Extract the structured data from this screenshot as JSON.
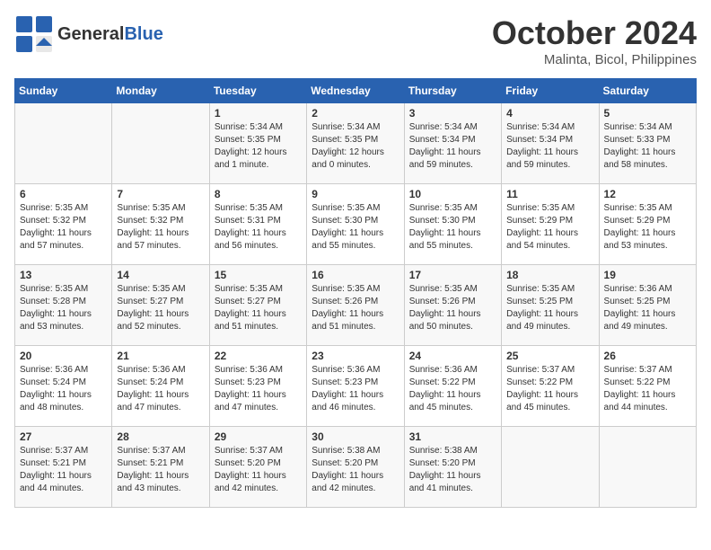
{
  "header": {
    "logo_general": "General",
    "logo_blue": "Blue",
    "month": "October 2024",
    "location": "Malinta, Bicol, Philippines"
  },
  "days_of_week": [
    "Sunday",
    "Monday",
    "Tuesday",
    "Wednesday",
    "Thursday",
    "Friday",
    "Saturday"
  ],
  "weeks": [
    [
      {
        "day": "",
        "info": ""
      },
      {
        "day": "",
        "info": ""
      },
      {
        "day": "1",
        "info": "Sunrise: 5:34 AM\nSunset: 5:35 PM\nDaylight: 12 hours\nand 1 minute."
      },
      {
        "day": "2",
        "info": "Sunrise: 5:34 AM\nSunset: 5:35 PM\nDaylight: 12 hours\nand 0 minutes."
      },
      {
        "day": "3",
        "info": "Sunrise: 5:34 AM\nSunset: 5:34 PM\nDaylight: 11 hours\nand 59 minutes."
      },
      {
        "day": "4",
        "info": "Sunrise: 5:34 AM\nSunset: 5:34 PM\nDaylight: 11 hours\nand 59 minutes."
      },
      {
        "day": "5",
        "info": "Sunrise: 5:34 AM\nSunset: 5:33 PM\nDaylight: 11 hours\nand 58 minutes."
      }
    ],
    [
      {
        "day": "6",
        "info": "Sunrise: 5:35 AM\nSunset: 5:32 PM\nDaylight: 11 hours\nand 57 minutes."
      },
      {
        "day": "7",
        "info": "Sunrise: 5:35 AM\nSunset: 5:32 PM\nDaylight: 11 hours\nand 57 minutes."
      },
      {
        "day": "8",
        "info": "Sunrise: 5:35 AM\nSunset: 5:31 PM\nDaylight: 11 hours\nand 56 minutes."
      },
      {
        "day": "9",
        "info": "Sunrise: 5:35 AM\nSunset: 5:30 PM\nDaylight: 11 hours\nand 55 minutes."
      },
      {
        "day": "10",
        "info": "Sunrise: 5:35 AM\nSunset: 5:30 PM\nDaylight: 11 hours\nand 55 minutes."
      },
      {
        "day": "11",
        "info": "Sunrise: 5:35 AM\nSunset: 5:29 PM\nDaylight: 11 hours\nand 54 minutes."
      },
      {
        "day": "12",
        "info": "Sunrise: 5:35 AM\nSunset: 5:29 PM\nDaylight: 11 hours\nand 53 minutes."
      }
    ],
    [
      {
        "day": "13",
        "info": "Sunrise: 5:35 AM\nSunset: 5:28 PM\nDaylight: 11 hours\nand 53 minutes."
      },
      {
        "day": "14",
        "info": "Sunrise: 5:35 AM\nSunset: 5:27 PM\nDaylight: 11 hours\nand 52 minutes."
      },
      {
        "day": "15",
        "info": "Sunrise: 5:35 AM\nSunset: 5:27 PM\nDaylight: 11 hours\nand 51 minutes."
      },
      {
        "day": "16",
        "info": "Sunrise: 5:35 AM\nSunset: 5:26 PM\nDaylight: 11 hours\nand 51 minutes."
      },
      {
        "day": "17",
        "info": "Sunrise: 5:35 AM\nSunset: 5:26 PM\nDaylight: 11 hours\nand 50 minutes."
      },
      {
        "day": "18",
        "info": "Sunrise: 5:35 AM\nSunset: 5:25 PM\nDaylight: 11 hours\nand 49 minutes."
      },
      {
        "day": "19",
        "info": "Sunrise: 5:36 AM\nSunset: 5:25 PM\nDaylight: 11 hours\nand 49 minutes."
      }
    ],
    [
      {
        "day": "20",
        "info": "Sunrise: 5:36 AM\nSunset: 5:24 PM\nDaylight: 11 hours\nand 48 minutes."
      },
      {
        "day": "21",
        "info": "Sunrise: 5:36 AM\nSunset: 5:24 PM\nDaylight: 11 hours\nand 47 minutes."
      },
      {
        "day": "22",
        "info": "Sunrise: 5:36 AM\nSunset: 5:23 PM\nDaylight: 11 hours\nand 47 minutes."
      },
      {
        "day": "23",
        "info": "Sunrise: 5:36 AM\nSunset: 5:23 PM\nDaylight: 11 hours\nand 46 minutes."
      },
      {
        "day": "24",
        "info": "Sunrise: 5:36 AM\nSunset: 5:22 PM\nDaylight: 11 hours\nand 45 minutes."
      },
      {
        "day": "25",
        "info": "Sunrise: 5:37 AM\nSunset: 5:22 PM\nDaylight: 11 hours\nand 45 minutes."
      },
      {
        "day": "26",
        "info": "Sunrise: 5:37 AM\nSunset: 5:22 PM\nDaylight: 11 hours\nand 44 minutes."
      }
    ],
    [
      {
        "day": "27",
        "info": "Sunrise: 5:37 AM\nSunset: 5:21 PM\nDaylight: 11 hours\nand 44 minutes."
      },
      {
        "day": "28",
        "info": "Sunrise: 5:37 AM\nSunset: 5:21 PM\nDaylight: 11 hours\nand 43 minutes."
      },
      {
        "day": "29",
        "info": "Sunrise: 5:37 AM\nSunset: 5:20 PM\nDaylight: 11 hours\nand 42 minutes."
      },
      {
        "day": "30",
        "info": "Sunrise: 5:38 AM\nSunset: 5:20 PM\nDaylight: 11 hours\nand 42 minutes."
      },
      {
        "day": "31",
        "info": "Sunrise: 5:38 AM\nSunset: 5:20 PM\nDaylight: 11 hours\nand 41 minutes."
      },
      {
        "day": "",
        "info": ""
      },
      {
        "day": "",
        "info": ""
      }
    ]
  ]
}
